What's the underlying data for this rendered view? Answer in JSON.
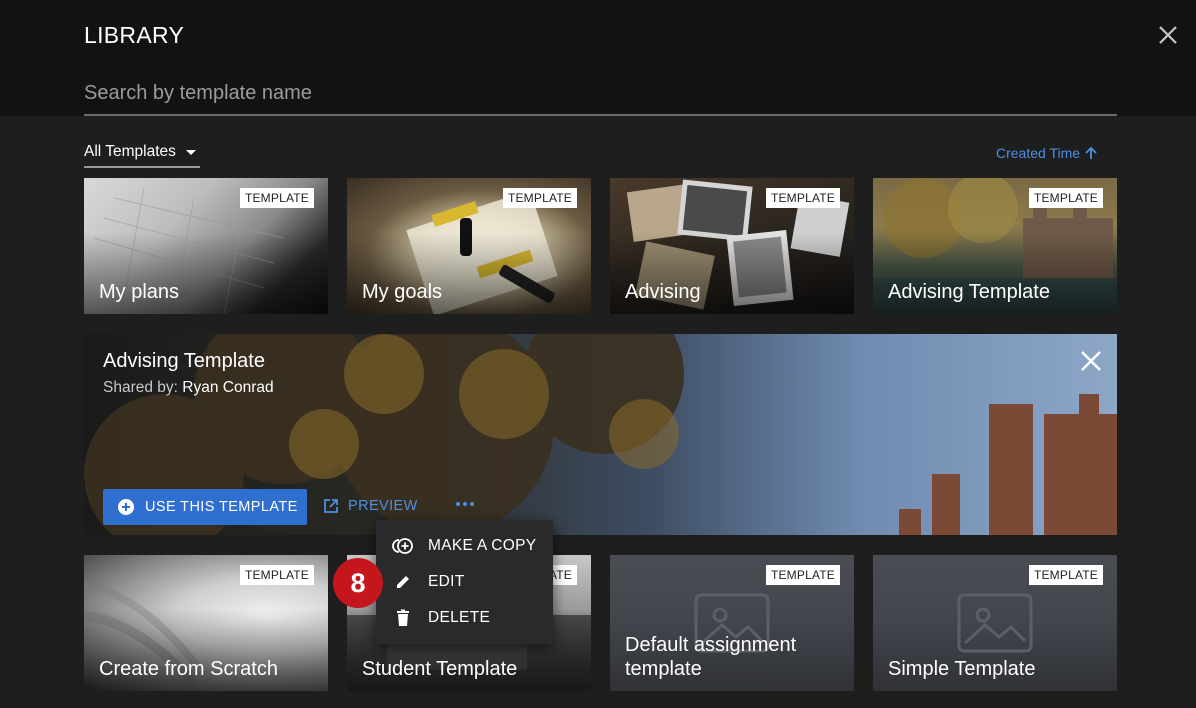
{
  "header": {
    "title": "LIBRARY",
    "search_placeholder": "Search by template name"
  },
  "toolbar": {
    "filter_label": "All Templates",
    "sort_label": "Created Time"
  },
  "cards_top": [
    {
      "badge": "TEMPLATE",
      "name": "My plans"
    },
    {
      "badge": "TEMPLATE",
      "name": "My goals"
    },
    {
      "badge": "TEMPLATE",
      "name": "Advising"
    },
    {
      "badge": "TEMPLATE",
      "name": "Advising Template"
    }
  ],
  "detail": {
    "title": "Advising Template",
    "shared_prefix": "Shared by:",
    "shared_by": "Ryan Conrad",
    "use_button": "USE THIS TEMPLATE",
    "preview": "PREVIEW"
  },
  "menu": {
    "items": [
      "MAKE A COPY",
      "EDIT",
      "DELETE"
    ]
  },
  "step_marker": "8",
  "cards_bottom": [
    {
      "badge": "TEMPLATE",
      "name": "Create from Scratch"
    },
    {
      "badge": "TEMPLATE",
      "name": "Student Template"
    },
    {
      "badge": "TEMPLATE",
      "name": "Default assignment template"
    },
    {
      "badge": "TEMPLATE",
      "name": "Simple Template"
    }
  ],
  "colors": {
    "accent": "#4d8fe0",
    "primary_button": "#2f6fd0",
    "step_marker": "#c4161c"
  }
}
